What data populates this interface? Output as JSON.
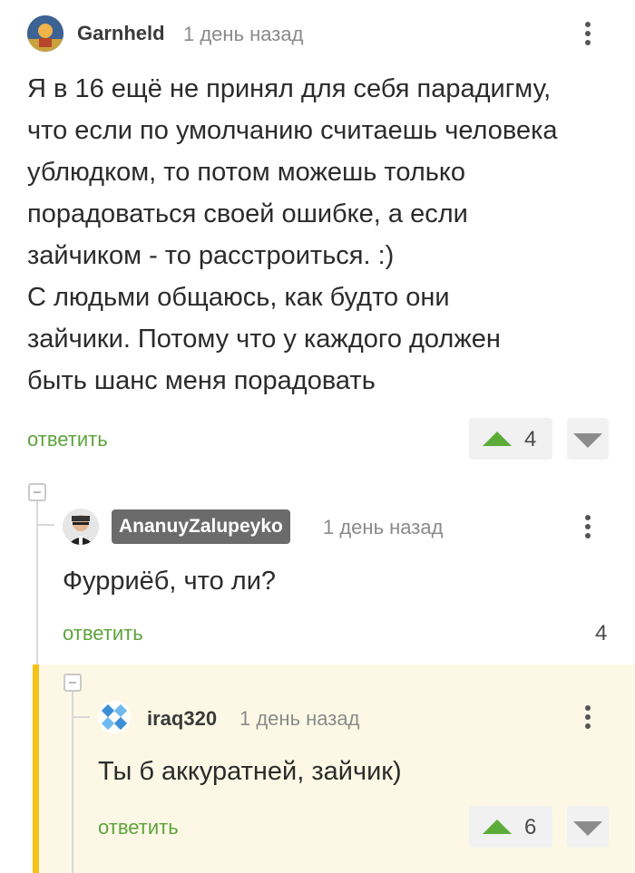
{
  "comments": [
    {
      "user": "Garnheld",
      "time": "1 день назад",
      "text": "Я в 16 ещё не принял для себя парадигму,\nчто если по умолчанию считаешь человека\nублюдком, то потом можешь только\nпорадоваться своей ошибке, а если\nзайчиком - то расстроиться. :)\nС людьми общаюсь, как будто они\nзайчики. Потому что у каждого должен\nбыть шанс меня порадовать",
      "reply_label": "ответить",
      "rating": "4"
    },
    {
      "user": "AnanuyZalupeyko",
      "time": "1 день назад",
      "text": "Фурриёб, что ли?",
      "reply_label": "ответить",
      "rating": "4"
    },
    {
      "user": "iraq320",
      "time": "1 день назад",
      "text": "Ты б аккуратней, зайчик)",
      "reply_label": "ответить",
      "rating": "6"
    }
  ],
  "colors": {
    "accent_green": "#5ea33c",
    "highlight_bg": "#fdf8e6",
    "highlight_bar": "#f2c318",
    "author_badge": "#6b6b6b"
  },
  "icons": [
    "avatar",
    "more-vertical-icon",
    "upvote-arrow-icon",
    "downvote-arrow-icon",
    "collapse-thread-icon"
  ]
}
